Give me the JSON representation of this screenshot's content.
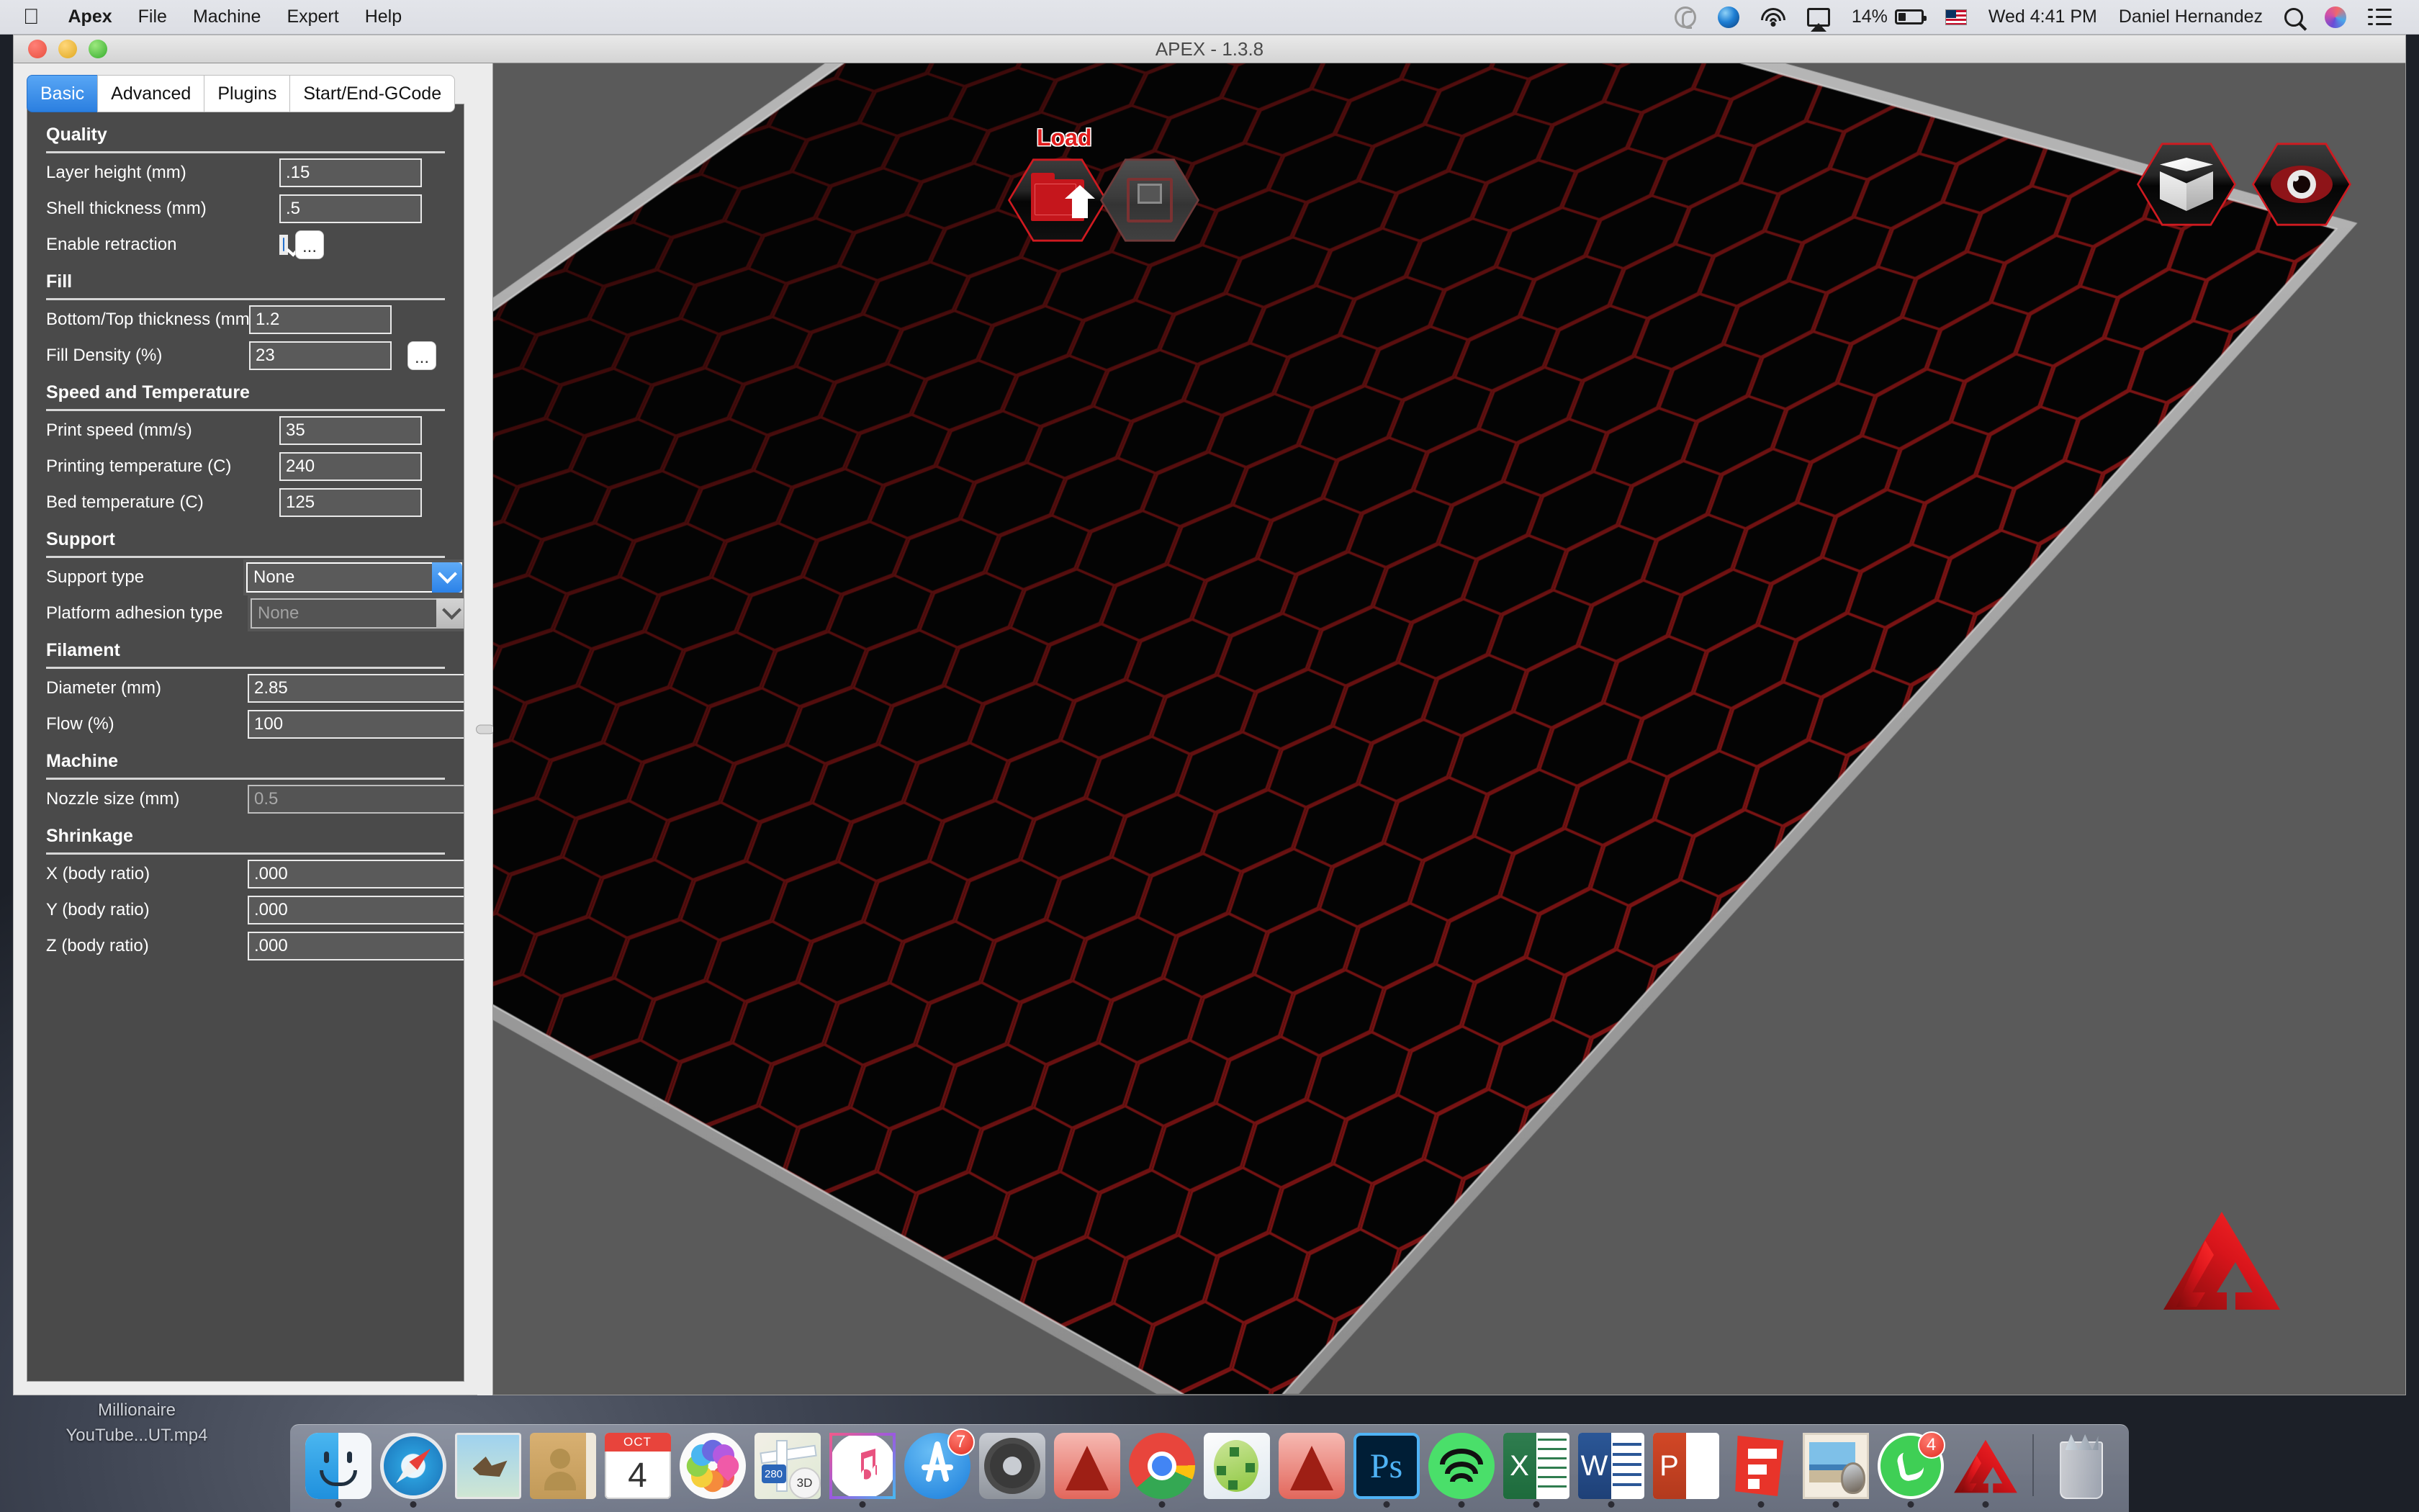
{
  "menubar": {
    "apple_icon": "apple-icon",
    "items": [
      {
        "label": "Apex",
        "bold": true
      },
      {
        "label": "File",
        "bold": false
      },
      {
        "label": "Machine",
        "bold": false
      },
      {
        "label": "Expert",
        "bold": false
      },
      {
        "label": "Help",
        "bold": false
      }
    ],
    "status": {
      "creative_cloud_icon": "creative-cloud-icon",
      "dropbox_icon": "blue-orb-icon",
      "wifi_icon": "wifi-icon",
      "airplay_icon": "airplay-icon",
      "battery_percent": "14%",
      "battery_icon": "battery-icon",
      "input_source_icon": "us-flag-icon",
      "clock": "Wed 4:41 PM",
      "user": "Daniel Hernandez",
      "search_icon": "search-icon",
      "siri_icon": "siri-icon",
      "notification_center_icon": "notification-center-icon"
    }
  },
  "window": {
    "title": "APEX - 1.3.8",
    "traffic": {
      "close": "close-button",
      "minimize": "minimize-button",
      "zoom": "zoom-button"
    }
  },
  "tabs": [
    {
      "label": "Basic",
      "active": true
    },
    {
      "label": "Advanced",
      "active": false
    },
    {
      "label": "Plugins",
      "active": false
    },
    {
      "label": "Start/End-GCode",
      "active": false
    }
  ],
  "settings": {
    "sections": [
      {
        "title": "Quality",
        "rows": [
          {
            "label": "Layer height (mm)",
            "type": "text",
            "value": ".15",
            "disabled": false,
            "more": false
          },
          {
            "label": "Shell thickness (mm)",
            "type": "text",
            "value": ".5",
            "disabled": false,
            "more": false
          },
          {
            "label": "Enable retraction",
            "type": "checkbox",
            "value": "checked",
            "disabled": false,
            "more": true
          }
        ]
      },
      {
        "title": "Fill",
        "rows": [
          {
            "label": "Bottom/Top thickness (mm)",
            "type": "text",
            "value": "1.2",
            "disabled": false,
            "more": false
          },
          {
            "label": "Fill Density (%)",
            "type": "text",
            "value": "23",
            "disabled": false,
            "more": true
          }
        ]
      },
      {
        "title": "Speed and Temperature",
        "rows": [
          {
            "label": "Print speed (mm/s)",
            "type": "text",
            "value": "35",
            "disabled": false,
            "more": false
          },
          {
            "label": "Printing temperature (C)",
            "type": "text",
            "value": "240",
            "disabled": false,
            "more": false
          },
          {
            "label": "Bed temperature (C)",
            "type": "text",
            "value": "125",
            "disabled": false,
            "more": false
          }
        ]
      },
      {
        "title": "Support",
        "rows": [
          {
            "label": "Support type",
            "type": "select",
            "value": "None",
            "disabled": false,
            "more": true
          },
          {
            "label": "Platform adhesion type",
            "type": "select",
            "value": "None",
            "disabled": true,
            "more": true
          }
        ]
      },
      {
        "title": "Filament",
        "rows": [
          {
            "label": "Diameter (mm)",
            "type": "text",
            "value": "2.85",
            "disabled": false,
            "more": false
          },
          {
            "label": "Flow (%)",
            "type": "text",
            "value": "100",
            "disabled": false,
            "more": false
          }
        ]
      },
      {
        "title": "Machine",
        "rows": [
          {
            "label": "Nozzle size (mm)",
            "type": "text",
            "value": "0.5",
            "disabled": true,
            "more": false
          }
        ]
      },
      {
        "title": "Shrinkage",
        "rows": [
          {
            "label": "X (body ratio)",
            "type": "text",
            "value": ".000",
            "disabled": false,
            "more": false
          },
          {
            "label": "Y (body ratio)",
            "type": "text",
            "value": ".000",
            "disabled": false,
            "more": false
          },
          {
            "label": "Z (body ratio)",
            "type": "text",
            "value": ".000",
            "disabled": false,
            "more": false
          }
        ]
      }
    ]
  },
  "viewport": {
    "load_label": "Load",
    "load_button_icon": "folder-upload-icon",
    "save_button_icon": "floppy-disk-icon",
    "view_cube_icon": "cube-icon",
    "view_eye_icon": "eye-icon",
    "watermark_icon": "apex-logo-icon",
    "colors": {
      "accent_red": "#cf1a20",
      "plate_grid": "#5a0f10",
      "plate_bg": "#040404",
      "viewport_bg": "#5a5a5a"
    }
  },
  "desktop": {
    "file_line1": "Millionaire",
    "file_line2": "YouTube...UT.mp4"
  },
  "dock": {
    "items": [
      {
        "name": "finder",
        "label": "Finder",
        "running": true,
        "badge": null
      },
      {
        "name": "safari",
        "label": "Safari",
        "running": true,
        "badge": null
      },
      {
        "name": "mail",
        "label": "Mail",
        "running": false,
        "badge": null
      },
      {
        "name": "contacts",
        "label": "Contacts",
        "running": false,
        "badge": null
      },
      {
        "name": "calendar",
        "label": "Calendar",
        "running": false,
        "badge": null,
        "month": "OCT",
        "day": "4"
      },
      {
        "name": "photos",
        "label": "Photos",
        "running": false,
        "badge": null
      },
      {
        "name": "maps",
        "label": "Maps",
        "running": false,
        "badge": null,
        "route": "280",
        "mode": "3D"
      },
      {
        "name": "itunes",
        "label": "iTunes",
        "running": true,
        "badge": null
      },
      {
        "name": "app-store",
        "label": "App Store",
        "running": false,
        "badge": "7"
      },
      {
        "name": "system-preferences",
        "label": "System Preferences",
        "running": false,
        "badge": null
      },
      {
        "name": "autocad",
        "label": "AutoCAD",
        "running": false,
        "badge": null
      },
      {
        "name": "chrome",
        "label": "Google Chrome",
        "running": true,
        "badge": null
      },
      {
        "name": "meshmixer",
        "label": "Meshmixer",
        "running": false,
        "badge": null
      },
      {
        "name": "autocad-2",
        "label": "AutoCAD",
        "running": false,
        "badge": null
      },
      {
        "name": "photoshop",
        "label": "Adobe Photoshop",
        "running": true,
        "badge": null
      },
      {
        "name": "spotify",
        "label": "Spotify",
        "running": true,
        "badge": null
      },
      {
        "name": "excel",
        "label": "Microsoft Excel",
        "running": true,
        "badge": null,
        "letter": "X"
      },
      {
        "name": "word",
        "label": "Microsoft Word",
        "running": true,
        "badge": null,
        "letter": "W"
      },
      {
        "name": "powerpoint",
        "label": "Microsoft PowerPoint",
        "running": false,
        "badge": null,
        "letter": "P"
      },
      {
        "name": "sketchup",
        "label": "SketchUp",
        "running": true,
        "badge": null
      },
      {
        "name": "preview",
        "label": "Preview",
        "running": true,
        "badge": null
      },
      {
        "name": "whatsapp",
        "label": "WhatsApp",
        "running": true,
        "badge": "4"
      },
      {
        "name": "apex",
        "label": "Apex",
        "running": true,
        "badge": null
      }
    ],
    "trash_label": "Trash"
  }
}
